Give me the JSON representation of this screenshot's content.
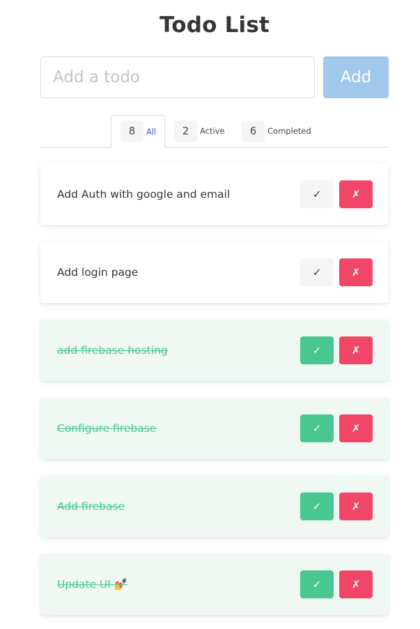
{
  "title": "Todo List",
  "input": {
    "placeholder": "Add a todo",
    "value": ""
  },
  "add_button_label": "Add",
  "tabs": [
    {
      "count": "8",
      "label": "All",
      "active": true
    },
    {
      "count": "2",
      "label": "Active",
      "active": false
    },
    {
      "count": "6",
      "label": "Completed",
      "active": false
    }
  ],
  "todos": [
    {
      "text": "Add Auth with google and email",
      "completed": false
    },
    {
      "text": "Add login page",
      "completed": false
    },
    {
      "text": "add firebase hosting",
      "completed": true
    },
    {
      "text": "Configure firebase",
      "completed": true
    },
    {
      "text": "Add firebase",
      "completed": true
    },
    {
      "text": "Update UI 💅",
      "completed": true
    }
  ],
  "check_symbol": "✓",
  "delete_symbol": "✗",
  "colors": {
    "add_button": "#a0c8ea",
    "active_tab_text": "#3e5bc7",
    "completed_bg": "#eff8f3",
    "completed_text": "#48c78e",
    "check_done": "#48c78e",
    "delete": "#f14668"
  }
}
